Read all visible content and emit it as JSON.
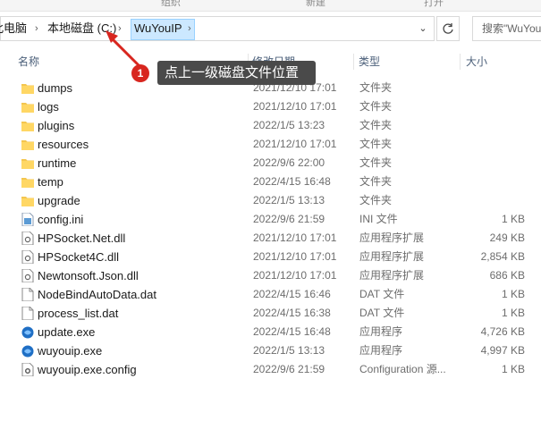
{
  "ribbon": {
    "left_label": "组织",
    "mid_label": "新建",
    "right_label": "打开"
  },
  "address": {
    "crumb1": "此电脑",
    "crumb2": "本地磁盘 (C:)",
    "crumb3": "WuYouIP",
    "search_placeholder": "搜索\"WuYou"
  },
  "columns": {
    "name": "名称",
    "date": "修改日期",
    "type": "类型",
    "size": "大小"
  },
  "annotation": {
    "number": "1",
    "text": "点上一级磁盘文件位置"
  },
  "files": [
    {
      "name": "dumps",
      "date": "2021/12/10 17:01",
      "type": "文件夹",
      "size": "",
      "icon": "folder-icon"
    },
    {
      "name": "logs",
      "date": "2021/12/10 17:01",
      "type": "文件夹",
      "size": "",
      "icon": "folder-icon"
    },
    {
      "name": "plugins",
      "date": "2022/1/5 13:23",
      "type": "文件夹",
      "size": "",
      "icon": "folder-icon"
    },
    {
      "name": "resources",
      "date": "2021/12/10 17:01",
      "type": "文件夹",
      "size": "",
      "icon": "folder-icon"
    },
    {
      "name": "runtime",
      "date": "2022/9/6 22:00",
      "type": "文件夹",
      "size": "",
      "icon": "folder-icon"
    },
    {
      "name": "temp",
      "date": "2022/4/15 16:48",
      "type": "文件夹",
      "size": "",
      "icon": "folder-icon"
    },
    {
      "name": "upgrade",
      "date": "2022/1/5 13:13",
      "type": "文件夹",
      "size": "",
      "icon": "folder-icon"
    },
    {
      "name": "config.ini",
      "date": "2022/9/6 21:59",
      "type": "INI 文件",
      "size": "1 KB",
      "icon": "ini-file-icon"
    },
    {
      "name": "HPSocket.Net.dll",
      "date": "2021/12/10 17:01",
      "type": "应用程序扩展",
      "size": "249 KB",
      "icon": "dll-file-icon"
    },
    {
      "name": "HPSocket4C.dll",
      "date": "2021/12/10 17:01",
      "type": "应用程序扩展",
      "size": "2,854 KB",
      "icon": "dll-file-icon"
    },
    {
      "name": "Newtonsoft.Json.dll",
      "date": "2021/12/10 17:01",
      "type": "应用程序扩展",
      "size": "686 KB",
      "icon": "dll-file-icon"
    },
    {
      "name": "NodeBindAutoData.dat",
      "date": "2022/4/15 16:46",
      "type": "DAT 文件",
      "size": "1 KB",
      "icon": "file-icon"
    },
    {
      "name": "process_list.dat",
      "date": "2022/4/15 16:38",
      "type": "DAT 文件",
      "size": "1 KB",
      "icon": "file-icon"
    },
    {
      "name": "update.exe",
      "date": "2022/4/15 16:48",
      "type": "应用程序",
      "size": "4,726 KB",
      "icon": "exe-blue-icon"
    },
    {
      "name": "wuyouip.exe",
      "date": "2022/1/5 13:13",
      "type": "应用程序",
      "size": "4,997 KB",
      "icon": "exe-blue-icon"
    },
    {
      "name": "wuyouip.exe.config",
      "date": "2022/9/6 21:59",
      "type": "Configuration 源...",
      "size": "1 KB",
      "icon": "config-file-icon"
    }
  ]
}
